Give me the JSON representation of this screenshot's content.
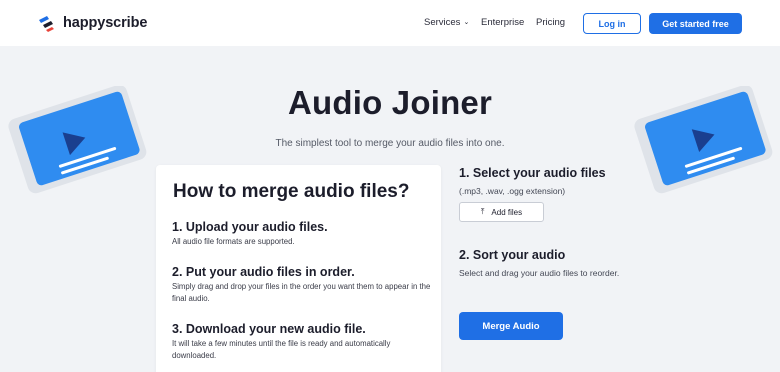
{
  "header": {
    "brand": "happyscribe",
    "nav": [
      {
        "label": "Services",
        "has_dropdown": true
      },
      {
        "label": "Enterprise"
      },
      {
        "label": "Pricing"
      }
    ],
    "login_label": "Log in",
    "cta_label": "Get started free"
  },
  "hero": {
    "title": "Audio Joiner",
    "subtitle": "The simplest tool to merge your audio files into one."
  },
  "howto": {
    "title": "How to merge audio files?",
    "steps": [
      {
        "heading": "1. Upload your audio files.",
        "text": "All audio file formats are supported."
      },
      {
        "heading": "2. Put your audio files in order.",
        "text": "Simply drag and drop your files in the order you want them to appear in the final audio."
      },
      {
        "heading": "3. Download your new audio file.",
        "text": "It will take a few minutes until the file is ready and automatically downloaded."
      }
    ]
  },
  "tool": {
    "select_heading": "1.  Select your audio files",
    "select_hint": "(.mp3, .wav, .ogg extension)",
    "add_files_label": "Add files",
    "sort_heading": "2. Sort your audio",
    "sort_hint": "Select and drag your audio files to reorder.",
    "merge_label": "Merge Audio"
  },
  "colors": {
    "accent": "#1f6fe5",
    "background": "#f1f3f6",
    "illustration_blue": "#2f8cf0"
  },
  "icons": [
    "happyscribe-logo-icon",
    "chevron-down-icon",
    "upload-icon",
    "video-play-illustration"
  ]
}
